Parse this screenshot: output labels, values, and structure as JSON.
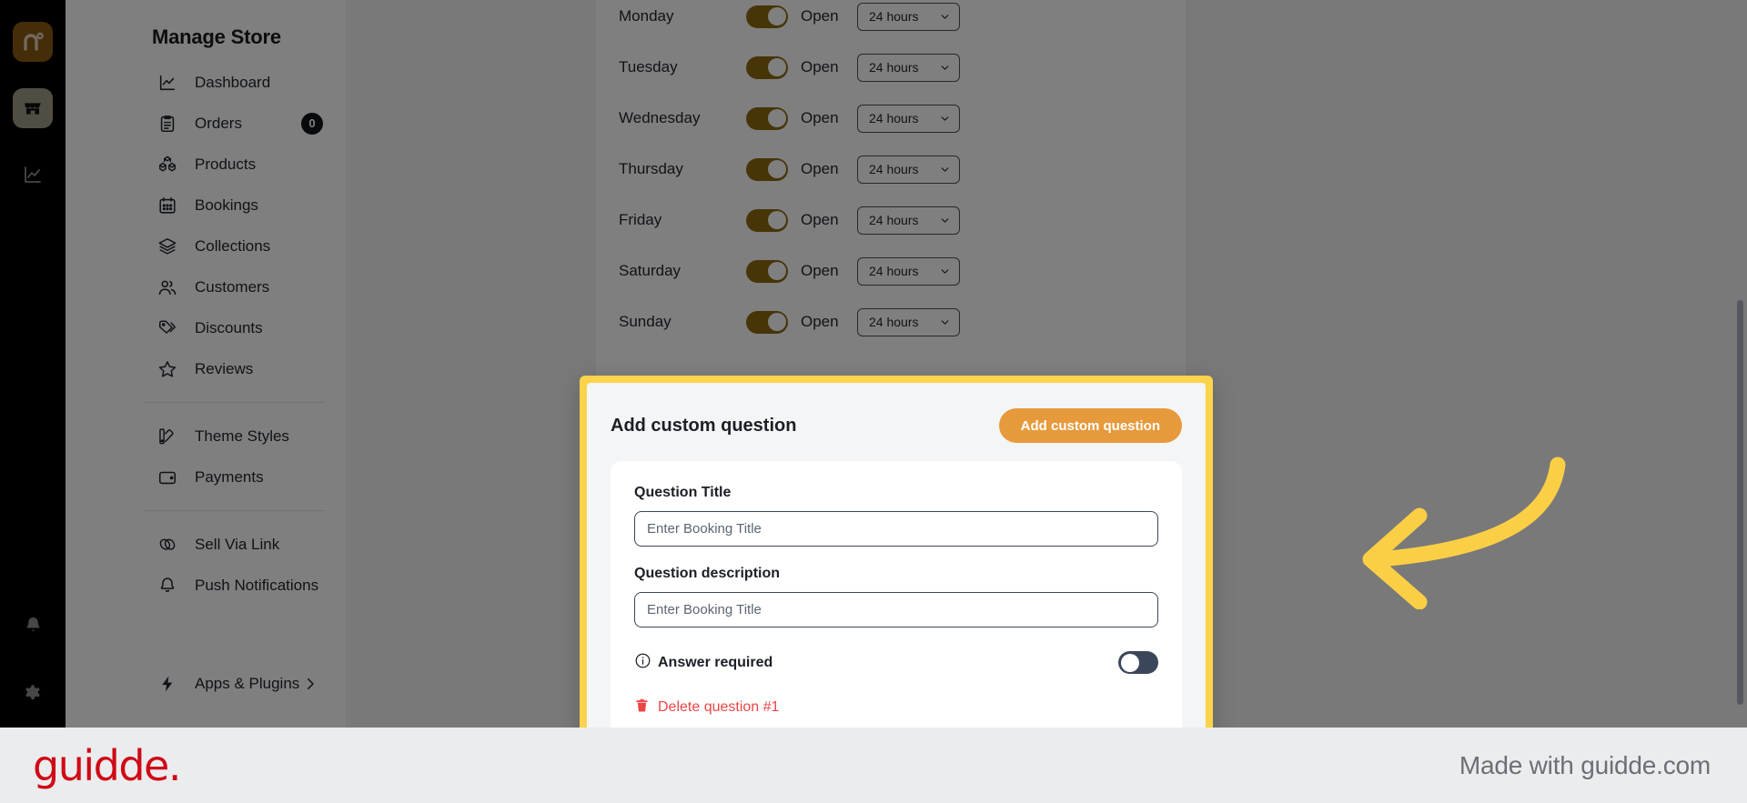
{
  "rail": {
    "logo_icon": "brand-logo-icon",
    "store_icon": "store-icon",
    "analytics_icon": "analytics-icon",
    "bell_icon": "bell-icon",
    "gear_icon": "gear-icon"
  },
  "sidebar": {
    "title": "Manage Store",
    "groups": [
      {
        "items": [
          {
            "label": "Dashboard",
            "icon": "chart-line-icon",
            "badge": null
          },
          {
            "label": "Orders",
            "icon": "clipboard-icon",
            "badge": "0"
          },
          {
            "label": "Products",
            "icon": "boxes-icon",
            "badge": null
          },
          {
            "label": "Bookings",
            "icon": "calendar-icon",
            "badge": null
          },
          {
            "label": "Collections",
            "icon": "layers-icon",
            "badge": null
          },
          {
            "label": "Customers",
            "icon": "users-icon",
            "badge": null
          },
          {
            "label": "Discounts",
            "icon": "tag-icon",
            "badge": null
          },
          {
            "label": "Reviews",
            "icon": "star-icon",
            "badge": null
          }
        ]
      },
      {
        "items": [
          {
            "label": "Theme Styles",
            "icon": "palette-icon",
            "badge": null
          },
          {
            "label": "Payments",
            "icon": "wallet-icon",
            "badge": null
          }
        ]
      },
      {
        "items": [
          {
            "label": "Sell Via Link",
            "icon": "link-icon",
            "badge": null
          },
          {
            "label": "Push Notifications",
            "icon": "bell-icon",
            "badge": null
          }
        ]
      }
    ],
    "apps": {
      "label": "Apps & Plugins",
      "icon": "bolt-icon",
      "chevron": "chevron-right-icon"
    }
  },
  "hours": {
    "state_label": "Open",
    "duration_value": "24 hours",
    "chevron": "chevron-down-icon",
    "days": [
      {
        "name": "Monday",
        "open": true,
        "duration": "24 hours"
      },
      {
        "name": "Tuesday",
        "open": true,
        "duration": "24 hours"
      },
      {
        "name": "Wednesday",
        "open": true,
        "duration": "24 hours"
      },
      {
        "name": "Thursday",
        "open": true,
        "duration": "24 hours"
      },
      {
        "name": "Friday",
        "open": true,
        "duration": "24 hours"
      },
      {
        "name": "Saturday",
        "open": true,
        "duration": "24 hours"
      },
      {
        "name": "Sunday",
        "open": true,
        "duration": "24 hours"
      }
    ]
  },
  "custom_question": {
    "section_title": "Add custom question",
    "add_button_label": "Add custom question",
    "title_label": "Question Title",
    "title_value": "",
    "title_placeholder": "Enter Booking Title",
    "description_label": "Question description",
    "description_value": "",
    "description_placeholder": "Enter Booking Title",
    "required_label": "Answer required",
    "required_info_icon": "info-icon",
    "required_toggle_on": false,
    "delete_label": "Delete question #1",
    "delete_icon": "trash-icon",
    "highlight_color": "#FCD34A",
    "accent_color": "#E79A3C",
    "danger_color": "#EF4444"
  },
  "annotation": {
    "arrow_icon": "curved-arrow-left-icon",
    "arrow_color": "#FBCF45"
  },
  "footer": {
    "logo_text": "guidde.",
    "logo_color": "#CF0A16",
    "made_with": "Made with guidde.com"
  }
}
